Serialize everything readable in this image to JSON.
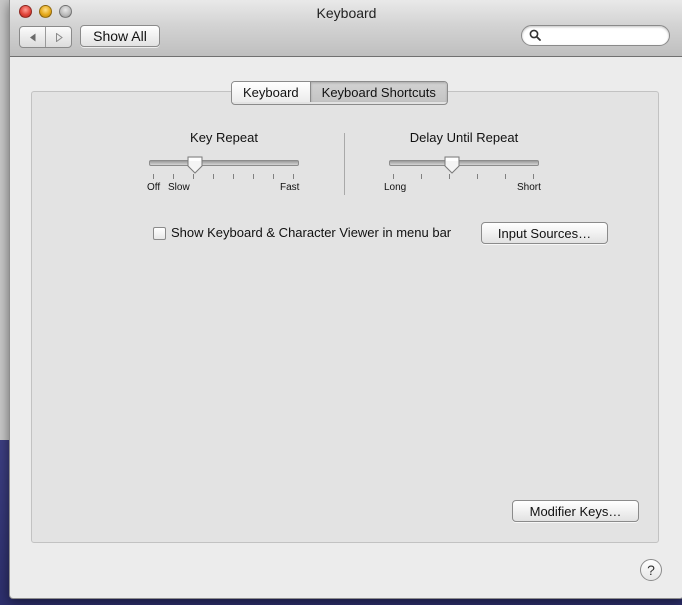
{
  "window": {
    "title": "Keyboard",
    "nav_back_icon": "chevron-left-icon",
    "nav_forward_icon": "chevron-right-icon",
    "show_all_label": "Show All",
    "search": {
      "value": "",
      "placeholder": "",
      "icon": "search-icon"
    }
  },
  "tabs": [
    {
      "label": "Keyboard",
      "selected": false
    },
    {
      "label": "Keyboard Shortcuts",
      "selected": true
    }
  ],
  "key_repeat": {
    "title": "Key Repeat",
    "tick_labels": [
      "Off",
      "Slow",
      "Fast"
    ],
    "tick_count": 8,
    "value_fraction": 0.3
  },
  "delay_until_repeat": {
    "title": "Delay Until Repeat",
    "tick_labels": [
      "Long",
      "Short"
    ],
    "tick_count": 6,
    "value_fraction": 0.42
  },
  "viewer_checkbox": {
    "label": "Show Keyboard & Character Viewer in menu bar",
    "checked": false
  },
  "buttons": {
    "input_sources": "Input Sources…",
    "modifier_keys": "Modifier Keys…",
    "help": "?"
  }
}
